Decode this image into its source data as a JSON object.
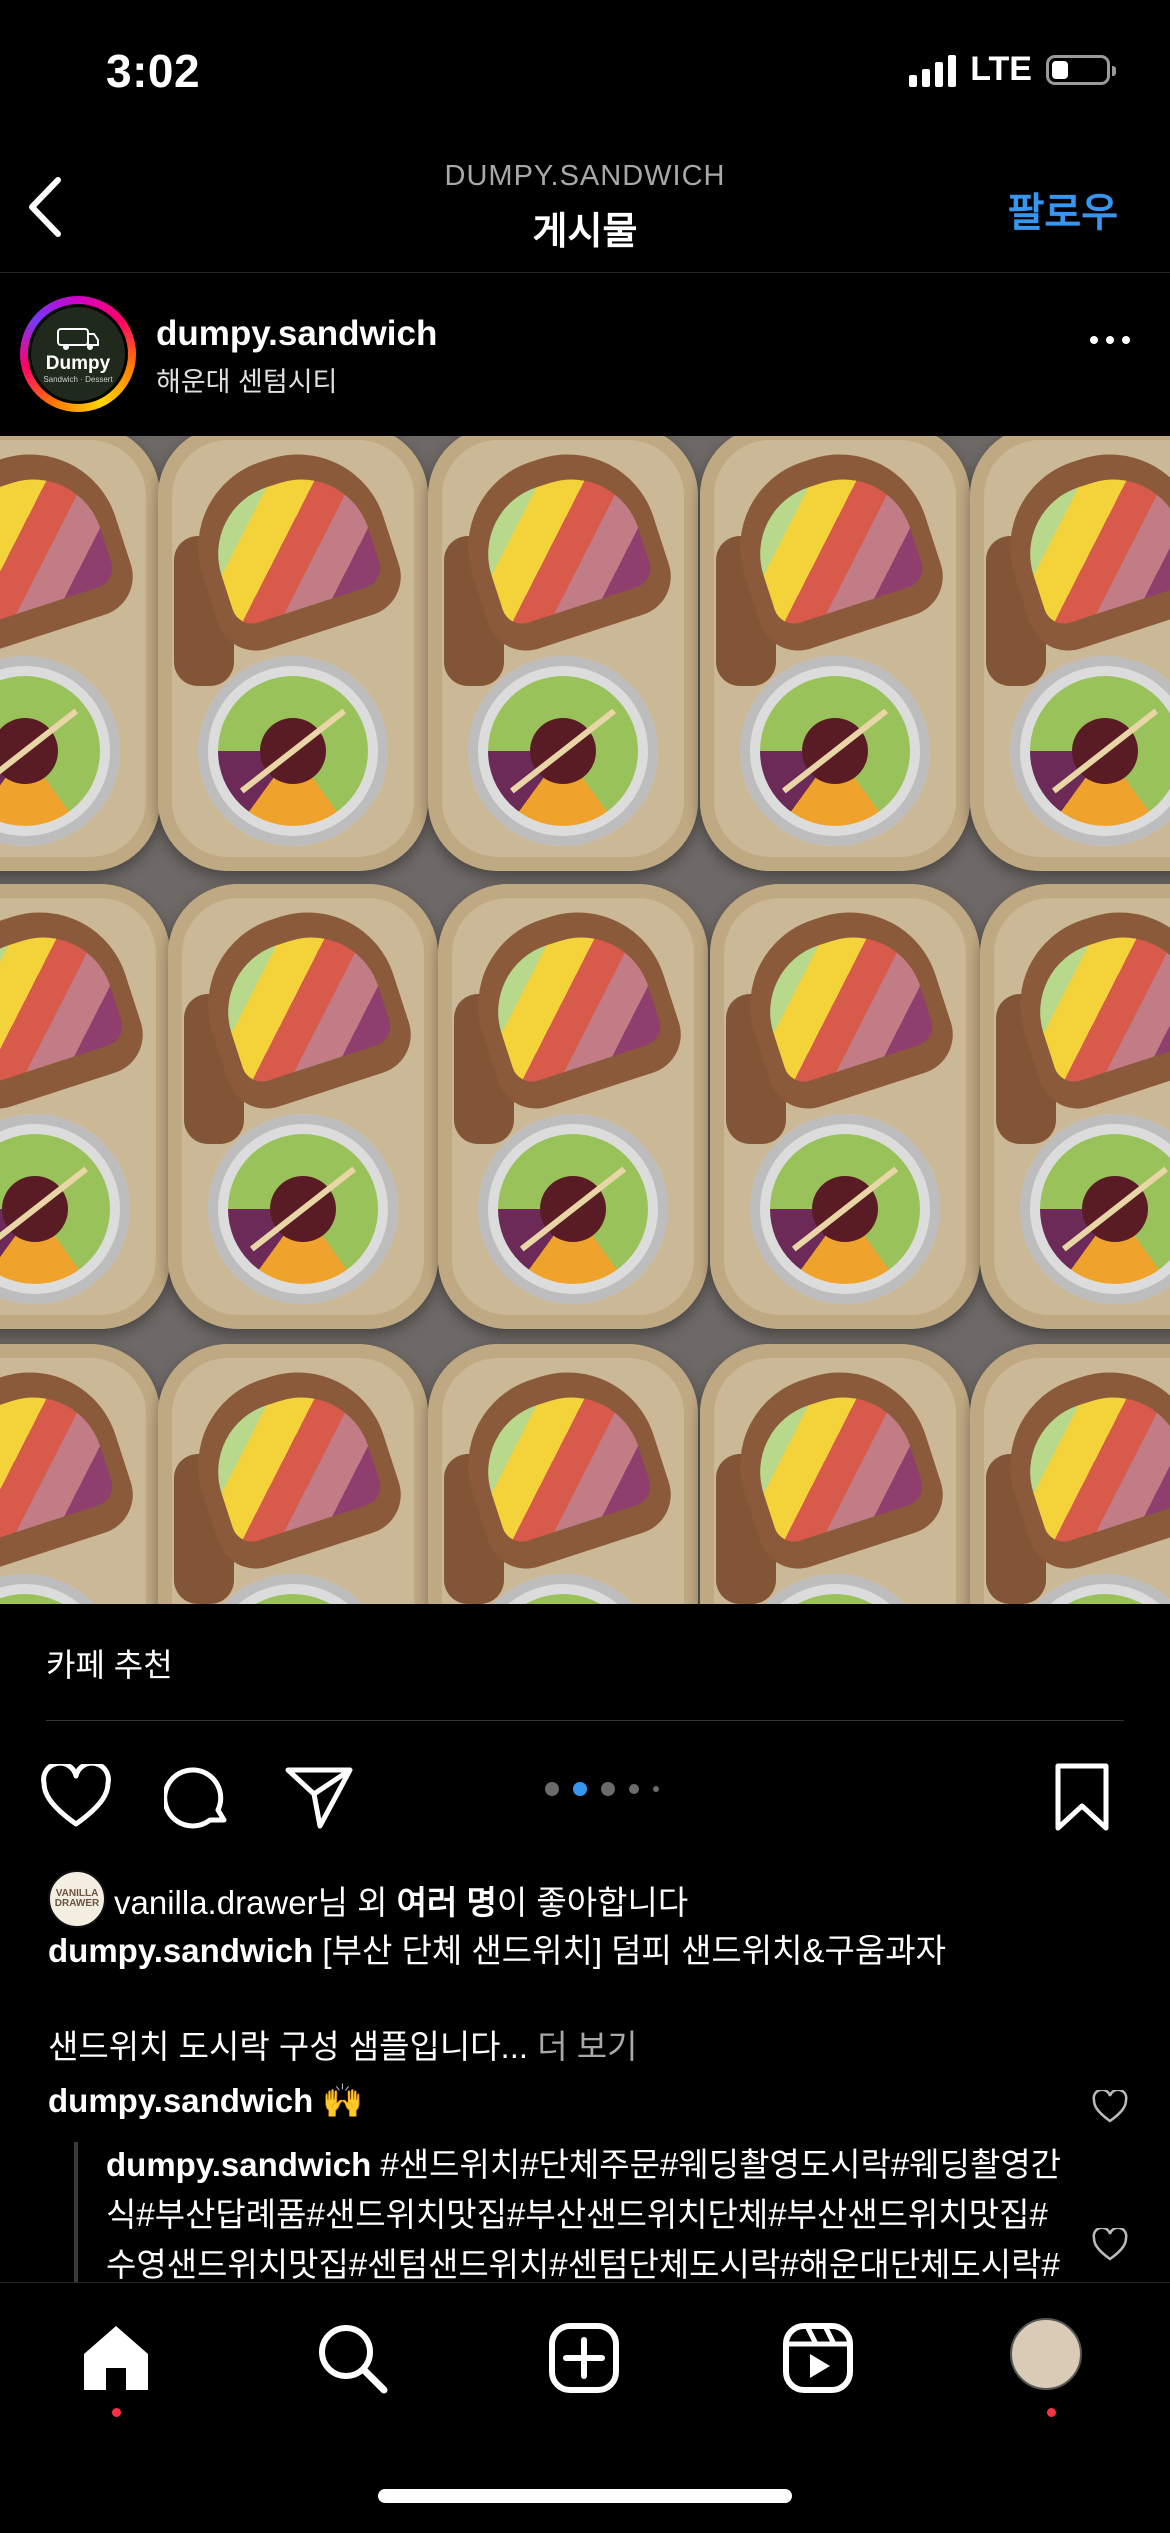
{
  "status_bar": {
    "time": "3:02",
    "network": "LTE"
  },
  "nav": {
    "account": "DUMPY.SANDWICH",
    "title": "게시물",
    "follow_label": "팔로우"
  },
  "post": {
    "username": "dumpy.sandwich",
    "location": "해운대 센텀시티",
    "avatar_brand": "Dumpy",
    "avatar_sub": "Sandwich · Dessert",
    "tag_label": "카페 추천",
    "carousel": {
      "count": 5,
      "active_index": 1
    }
  },
  "likes": {
    "avatar_text": "VANILLA DRAWER",
    "user": "vanilla.drawer",
    "text_mid": "님 외 ",
    "text_bold": "여러 명",
    "text_end": "이 좋아합니다"
  },
  "caption": {
    "username": "dumpy.sandwich",
    "line1": " [부산 단체 샌드위치] 덤피 샌드위치&구움과자",
    "line2": "샌드위치 도시락 구성 샘플입니다...",
    "more_label": " 더 보기"
  },
  "comments": [
    {
      "username": "dumpy.sandwich",
      "text": " 🙌"
    },
    {
      "username": "dumpy.sandwich",
      "text": " #샌드위치#단체주문#웨딩촬영도시락#웨딩촬영간식#부산답례품#샌드위치맛집#부산샌드위치단체#부산샌드위치맛집#수영샌드위치맛집#센텀샌드위치#센텀단체도시락#해운대단체도시락#센텀맛집#광안리도시락#센텀답례품#광안리카페"
    }
  ],
  "icons": {
    "back": "chevron-left-icon",
    "more": "more-horizontal-icon",
    "like": "heart-icon",
    "comment": "comment-icon",
    "share": "paper-plane-icon",
    "save": "bookmark-icon",
    "home": "home-icon",
    "search": "search-icon",
    "create": "plus-square-icon",
    "reels": "reels-icon"
  },
  "colors": {
    "accent": "#3797f0",
    "notification": "#ff3040",
    "background": "#000000"
  }
}
